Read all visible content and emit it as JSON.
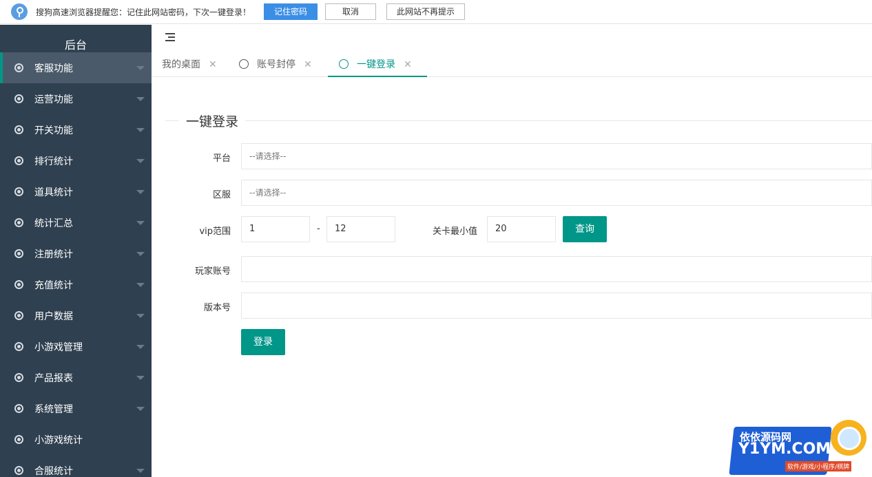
{
  "password_bar": {
    "message": "搜狗高速浏览器提醒您：记住此网站密码，下次一键登录！",
    "remember_label": "记住密码",
    "cancel_label": "取消",
    "never_label": "此网站不再提示"
  },
  "sidebar": {
    "brand": "后台",
    "items": [
      {
        "label": "客服功能"
      },
      {
        "label": "运营功能"
      },
      {
        "label": "开关功能"
      },
      {
        "label": "排行统计"
      },
      {
        "label": "道具统计"
      },
      {
        "label": "统计汇总"
      },
      {
        "label": "注册统计"
      },
      {
        "label": "充值统计"
      },
      {
        "label": "用户数据"
      },
      {
        "label": "小游戏管理"
      },
      {
        "label": "产品报表"
      },
      {
        "label": "系统管理"
      },
      {
        "label": "小游戏统计"
      },
      {
        "label": "合服统计"
      }
    ]
  },
  "tabs": [
    {
      "label": "我的桌面"
    },
    {
      "label": "账号封停"
    },
    {
      "label": "一键登录"
    }
  ],
  "form": {
    "legend": "一键登录",
    "platform_label": "平台",
    "platform_placeholder": "--请选择--",
    "server_label": "区服",
    "server_placeholder": "--请选择--",
    "vip_label": "vip范围",
    "vip_min": "1",
    "vip_sep": "-",
    "vip_max": "12",
    "level_label": "关卡最小值",
    "level_min": "20",
    "query_label": "查询",
    "account_label": "玩家账号",
    "account_value": "",
    "version_label": "版本号",
    "version_value": "",
    "login_label": "登录"
  },
  "watermark": {
    "line1": "依依源码网",
    "line2": "Y1YM.COM",
    "line3": "软件/游戏/小程序/棋牌"
  },
  "colors": {
    "sidebar_bg": "#2f4050",
    "accent": "#009688",
    "primary_blue": "#3b8ee6"
  }
}
